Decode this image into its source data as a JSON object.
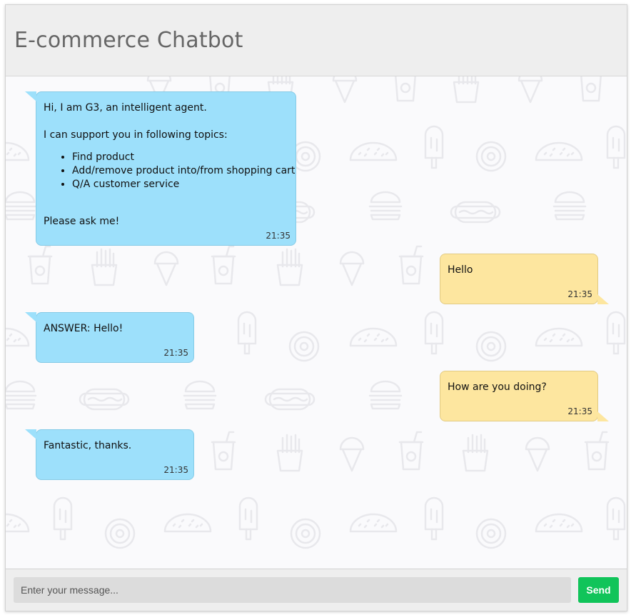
{
  "app": {
    "title": "E-commerce Chatbot"
  },
  "messages": [
    {
      "sender": "bot",
      "intro": "Hi, I am G3, an intelligent agent.",
      "topics_heading": "I can support you in following topics:",
      "topics": [
        "Find product",
        "Add/remove product into/from shopping cart",
        "Q/A customer service"
      ],
      "outro": "Please ask me!",
      "time": "21:35"
    },
    {
      "sender": "user",
      "text": "Hello",
      "time": "21:35"
    },
    {
      "sender": "bot",
      "text": "ANSWER: Hello!",
      "time": "21:35"
    },
    {
      "sender": "user",
      "text": "How are you doing?",
      "time": "21:35"
    },
    {
      "sender": "bot",
      "text": "Fantastic, thanks.",
      "time": "21:35"
    }
  ],
  "composer": {
    "placeholder": "Enter your message...",
    "send_label": "Send"
  },
  "colors": {
    "bot_bubble": "#9de0fb",
    "user_bubble": "#fde69f",
    "send_button": "#11c45a",
    "header_bg": "#eeeeee",
    "pattern_stroke": "#ececef"
  },
  "background_pattern_icons": [
    "cup-icon",
    "fries-icon",
    "ice-cream-icon",
    "popsicle-icon",
    "donut-icon",
    "taco-icon",
    "burger-icon",
    "hotdog-icon"
  ]
}
